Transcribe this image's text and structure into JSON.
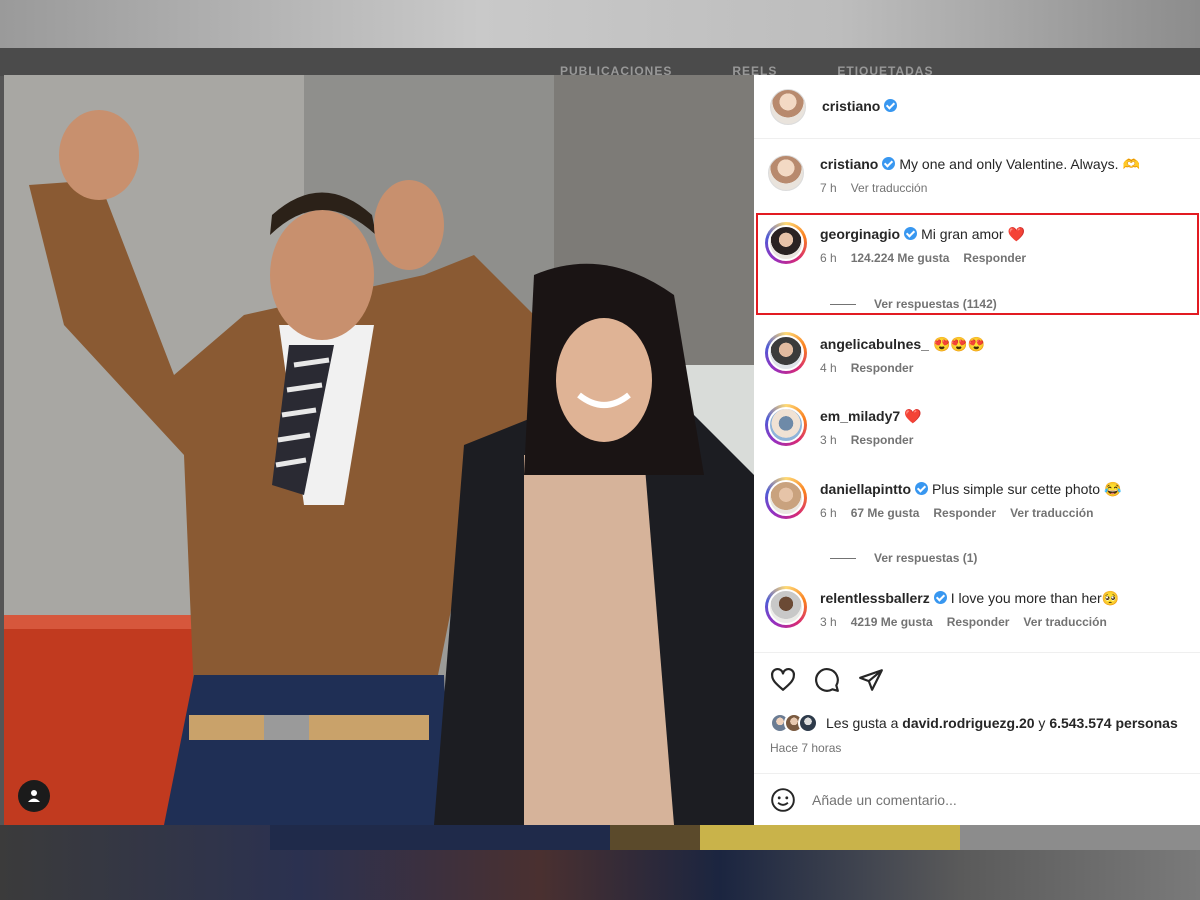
{
  "background_tabs": [
    "PUBLICACIONES",
    "REELS",
    "ETIQUETADAS"
  ],
  "post": {
    "author": "cristiano",
    "caption": {
      "username": "cristiano",
      "text": "My one and only Valentine. Always. 🫶",
      "time": "7 h",
      "translate": "Ver traducción"
    }
  },
  "comments": [
    {
      "username": "georginagio",
      "verified": true,
      "text": "Mi gran amor ❤️",
      "time": "6 h",
      "likes": "124.224 Me gusta",
      "reply": "Responder",
      "replies": "Ver respuestas (1142)",
      "highlighted": true
    },
    {
      "username": "angelicabulnes_",
      "verified": false,
      "text": "😍😍😍",
      "time": "4 h",
      "reply": "Responder"
    },
    {
      "username": "em_milady7",
      "verified": false,
      "text": "❤️",
      "time": "3 h",
      "reply": "Responder"
    },
    {
      "username": "daniellapintto",
      "verified": true,
      "text": "Plus simple sur cette photo 😂",
      "time": "6 h",
      "likes": "67 Me gusta",
      "reply": "Responder",
      "translate": "Ver traducción",
      "replies": "Ver respuestas (1)"
    },
    {
      "username": "relentlessballerz",
      "verified": true,
      "text": "I love you more than her🥺",
      "time": "3 h",
      "likes": "4219 Me gusta",
      "reply": "Responder",
      "translate": "Ver traducción"
    }
  ],
  "likes": {
    "prefix": "Les gusta a",
    "user": "david.rodriguezg.20",
    "and": "y",
    "count": "6.543.574 personas",
    "time_ago": "Hace 7 horas"
  },
  "add_comment": {
    "placeholder": "Añade un comentario..."
  },
  "colors": {
    "highlight_border": "#e21b22",
    "verified": "#3897f0",
    "heart": "#ed4956"
  },
  "icons": [
    "heart-icon",
    "comment-icon",
    "share-icon",
    "emoji-icon",
    "tag-person-icon"
  ]
}
